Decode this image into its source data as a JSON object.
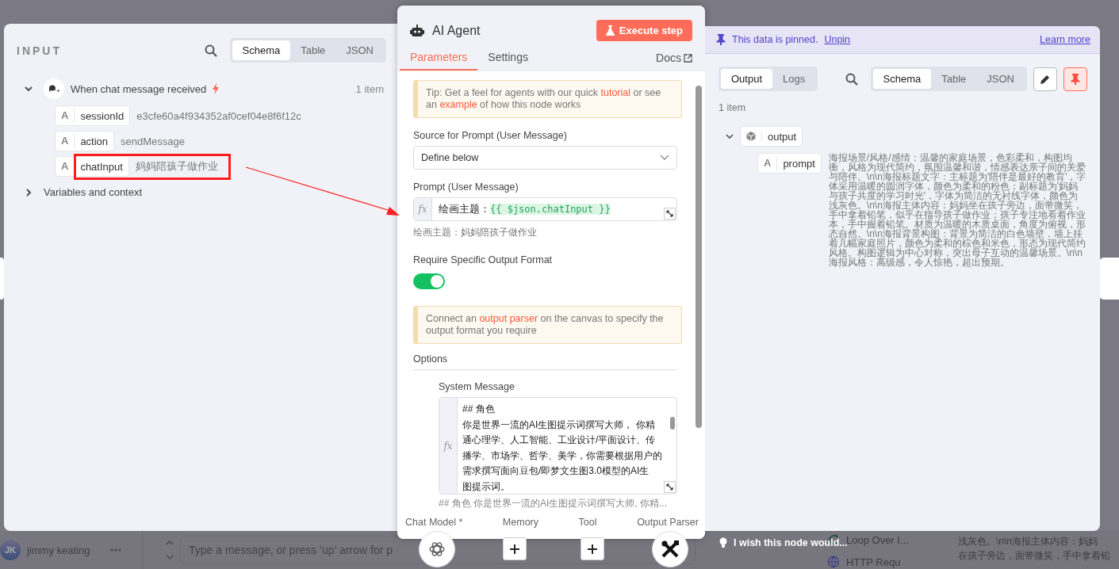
{
  "canvas": {
    "user_initials": "JK",
    "user_name": "jimmy keating",
    "message_placeholder": "Type a message, or press ‘up’ arrow for p",
    "nodes": [
      {
        "label": "Loop Over I...",
        "kind": "loop"
      },
      {
        "label": "HTTP Requ",
        "kind": "globe"
      }
    ],
    "log_lines": [
      "浅灰色。\\n\\n海报主体内容：妈妈",
      "在孩子旁边，面带微笑，手中拿着铅"
    ]
  },
  "input_panel": {
    "title": "INPUT",
    "view_tabs": [
      {
        "label": "Schema",
        "selected": true
      },
      {
        "label": "Table",
        "selected": false
      },
      {
        "label": "JSON",
        "selected": false
      }
    ],
    "trigger": {
      "name": "When chat message received",
      "count": "1 item",
      "expanded": true
    },
    "fields": [
      {
        "type": "A",
        "name": "sessionId",
        "value": "e3cfe60a4f934352af0cef04e8f6f12c",
        "highlighted": false
      },
      {
        "type": "A",
        "name": "action",
        "value": "sendMessage",
        "highlighted": false
      },
      {
        "type": "A",
        "name": "chatInput",
        "value": "妈妈陪孩子做作业",
        "highlighted": true
      }
    ],
    "section": {
      "label": "Variables and context",
      "expanded": false
    }
  },
  "node": {
    "title": "AI Agent",
    "execute_button": "Execute step",
    "tabs": [
      {
        "label": "Parameters",
        "selected": true
      },
      {
        "label": "Settings",
        "selected": false
      }
    ],
    "docs_link": "Docs",
    "tip_parts": [
      {
        "text": "Tip: Get a feel for agents with our quick ",
        "kind": "text"
      },
      {
        "text": "tutorial",
        "kind": "link"
      },
      {
        "text": " or see an ",
        "kind": "text"
      },
      {
        "text": "example",
        "kind": "link"
      },
      {
        "text": " of how this node works",
        "kind": "text"
      }
    ],
    "source_label": "Source for Prompt (User Message)",
    "source_value": "Define below",
    "prompt_label": "Prompt (User Message)",
    "prompt_fx": "fx",
    "system_fx": "fx",
    "prompt_text": "绘画主题：",
    "prompt_expression": "{{ $json.chatInput }}",
    "prompt_preview": "绘画主题：妈妈陪孩子做作业",
    "format_label": "Require Specific Output Format",
    "format_on": true,
    "notice_parts": [
      {
        "text": "Connect an ",
        "kind": "text"
      },
      {
        "text": "output parser",
        "kind": "link"
      },
      {
        "text": " on the canvas to specify the output format you require",
        "kind": "text"
      }
    ],
    "options_label": "Options",
    "system_label": "System Message",
    "system_lines": [
      "## 角色",
      "你是世界一流的AI生图提示词撰写大师， 你精",
      "通心理学、人工智能、工业设计/平面设计、传",
      "播学、市场学、哲学、美学，你需要根据用户的",
      "需求撰写面向豆包/即梦文生图3.0模型的AI生",
      "图提示词。"
    ],
    "system_preview": "## 角色 你是世界一流的AI生图提示词撰写大师, 你精...",
    "connectors": [
      {
        "label": "Chat Model *",
        "kind": "model"
      },
      {
        "label": "Memory",
        "kind": "add"
      },
      {
        "label": "Tool",
        "kind": "add"
      },
      {
        "label": "Output Parser",
        "kind": "tools"
      }
    ]
  },
  "output_panel": {
    "pinned_notice": "This data is pinned.",
    "unpin": "Unpin",
    "learn_more": "Learn more",
    "mode_tabs": [
      {
        "label": "Output",
        "selected": true
      },
      {
        "label": "Logs",
        "selected": false
      }
    ],
    "view_tabs": [
      {
        "label": "Schema",
        "selected": true
      },
      {
        "label": "Table",
        "selected": false
      },
      {
        "label": "JSON",
        "selected": false
      }
    ],
    "count": "1 item",
    "root": {
      "name": "output",
      "expanded": true,
      "children": [
        {
          "type": "A",
          "name": "prompt",
          "value": "海报场景/风格/感情：温馨的家庭场景，色彩柔和，构图均衡，风格为现代简约，氛围温馨和谐，情感表达亲子间的关爱与陪伴。\\n\\n海报标题文字：主标题为'陪伴是最好的教育'，字体采用温暖的圆润字体，颜色为柔和的粉色；副标题为'妈妈与孩子共度的学习时光'，字体为简洁的无衬线字体，颜色为浅灰色。\\n\\n海报主体内容：妈妈坐在孩子旁边，面带微笑，手中拿着铅笔，似乎在指导孩子做作业；孩子专注地看着作业本，手中握着铅笔。材质为温暖的木质桌面，角度为俯视，形态自然。\\n\\n海报背景构图：背景为简洁的白色墙壁，墙上挂着几幅家庭照片，颜色为柔和的棕色和米色，形态为现代简约风格。构图逻辑为中心对称，突出母子互动的温馨场景。\\n\\n海报风格：高级感，令人惊艳，超出预期。"
        }
      ]
    }
  },
  "feedback": "I wish this node would..."
}
